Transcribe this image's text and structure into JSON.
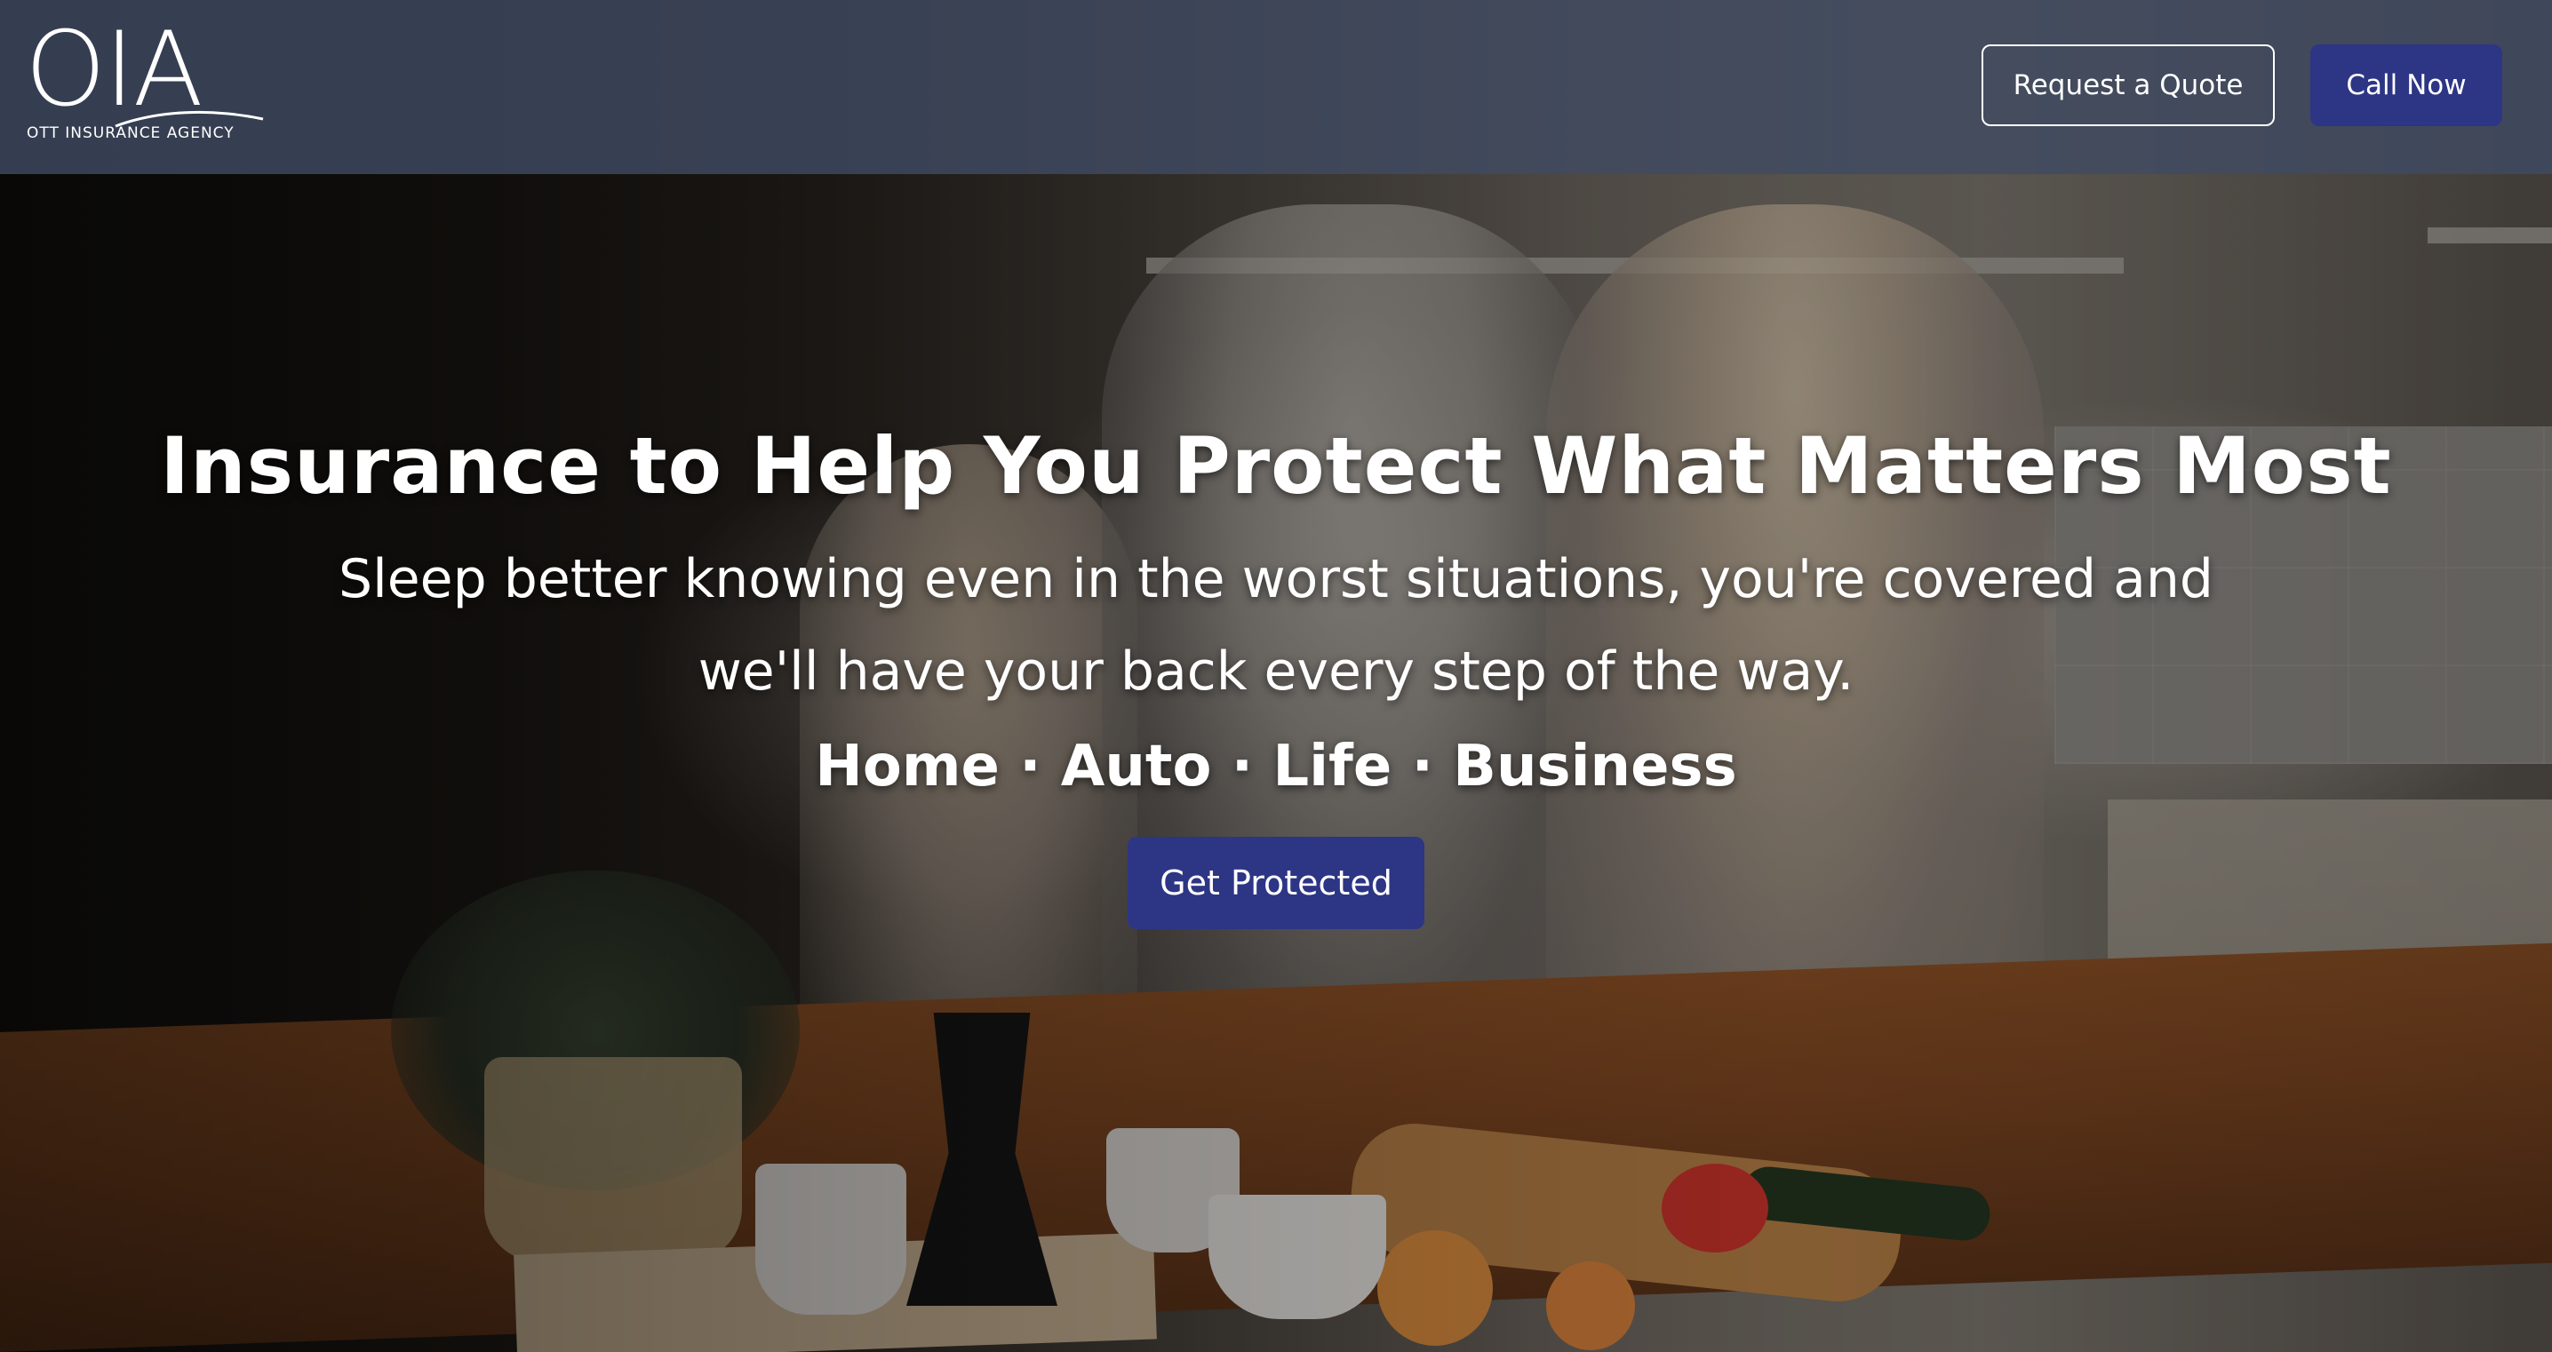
{
  "header": {
    "logo_mark": "OIA",
    "logo_subtitle": "OTT INSURANCE AGENCY",
    "quote_button": "Request a Quote",
    "call_button": "Call Now"
  },
  "hero": {
    "title": "Insurance to Help You Protect What Matters Most",
    "subtitle": "Sleep better knowing even in the worst situations, you're covered and we'll have your back every step of the way.",
    "lines_of_business": "Home · Auto · Life · Business",
    "cta_button": "Get Protected"
  },
  "colors": {
    "header_bg": "#404a62",
    "primary_button": "#2d3585",
    "text": "#ffffff"
  }
}
